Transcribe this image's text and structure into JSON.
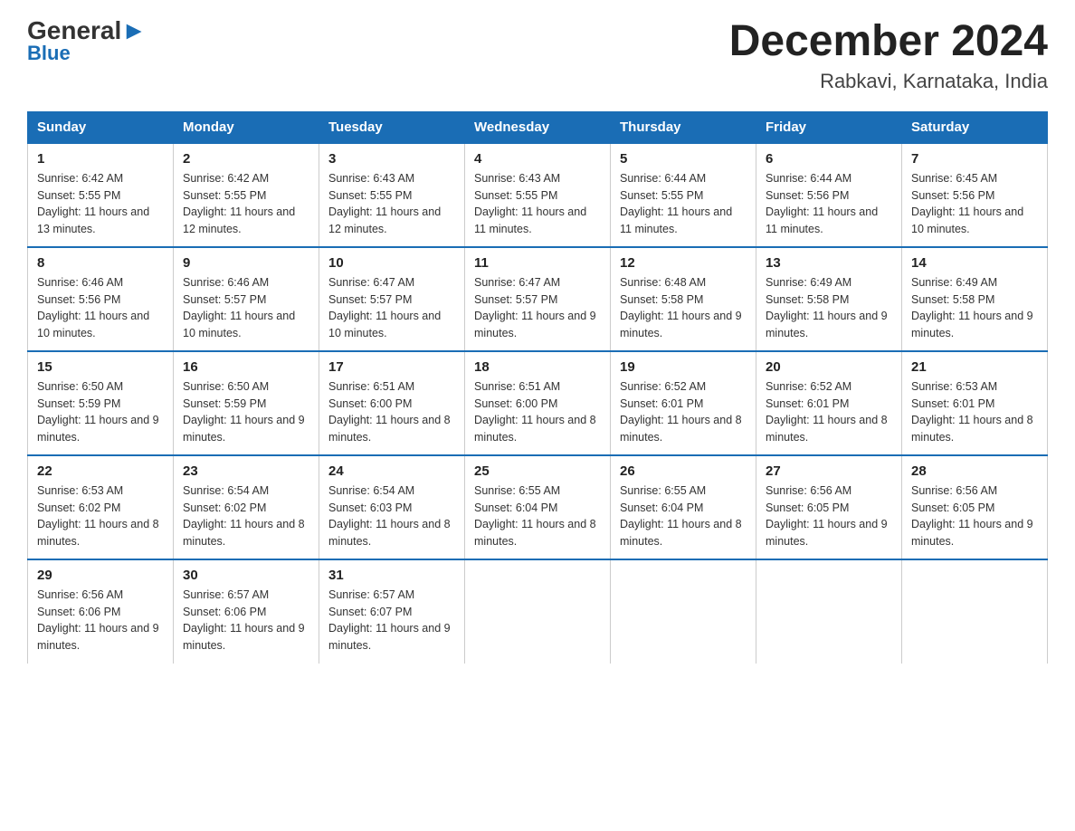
{
  "logo": {
    "general": "General",
    "blue": "Blue"
  },
  "title": "December 2024",
  "subtitle": "Rabkavi, Karnataka, India",
  "days": [
    "Sunday",
    "Monday",
    "Tuesday",
    "Wednesday",
    "Thursday",
    "Friday",
    "Saturday"
  ],
  "weeks": [
    [
      {
        "num": "1",
        "sunrise": "6:42 AM",
        "sunset": "5:55 PM",
        "daylight": "11 hours and 13 minutes."
      },
      {
        "num": "2",
        "sunrise": "6:42 AM",
        "sunset": "5:55 PM",
        "daylight": "11 hours and 12 minutes."
      },
      {
        "num": "3",
        "sunrise": "6:43 AM",
        "sunset": "5:55 PM",
        "daylight": "11 hours and 12 minutes."
      },
      {
        "num": "4",
        "sunrise": "6:43 AM",
        "sunset": "5:55 PM",
        "daylight": "11 hours and 11 minutes."
      },
      {
        "num": "5",
        "sunrise": "6:44 AM",
        "sunset": "5:55 PM",
        "daylight": "11 hours and 11 minutes."
      },
      {
        "num": "6",
        "sunrise": "6:44 AM",
        "sunset": "5:56 PM",
        "daylight": "11 hours and 11 minutes."
      },
      {
        "num": "7",
        "sunrise": "6:45 AM",
        "sunset": "5:56 PM",
        "daylight": "11 hours and 10 minutes."
      }
    ],
    [
      {
        "num": "8",
        "sunrise": "6:46 AM",
        "sunset": "5:56 PM",
        "daylight": "11 hours and 10 minutes."
      },
      {
        "num": "9",
        "sunrise": "6:46 AM",
        "sunset": "5:57 PM",
        "daylight": "11 hours and 10 minutes."
      },
      {
        "num": "10",
        "sunrise": "6:47 AM",
        "sunset": "5:57 PM",
        "daylight": "11 hours and 10 minutes."
      },
      {
        "num": "11",
        "sunrise": "6:47 AM",
        "sunset": "5:57 PM",
        "daylight": "11 hours and 9 minutes."
      },
      {
        "num": "12",
        "sunrise": "6:48 AM",
        "sunset": "5:58 PM",
        "daylight": "11 hours and 9 minutes."
      },
      {
        "num": "13",
        "sunrise": "6:49 AM",
        "sunset": "5:58 PM",
        "daylight": "11 hours and 9 minutes."
      },
      {
        "num": "14",
        "sunrise": "6:49 AM",
        "sunset": "5:58 PM",
        "daylight": "11 hours and 9 minutes."
      }
    ],
    [
      {
        "num": "15",
        "sunrise": "6:50 AM",
        "sunset": "5:59 PM",
        "daylight": "11 hours and 9 minutes."
      },
      {
        "num": "16",
        "sunrise": "6:50 AM",
        "sunset": "5:59 PM",
        "daylight": "11 hours and 9 minutes."
      },
      {
        "num": "17",
        "sunrise": "6:51 AM",
        "sunset": "6:00 PM",
        "daylight": "11 hours and 8 minutes."
      },
      {
        "num": "18",
        "sunrise": "6:51 AM",
        "sunset": "6:00 PM",
        "daylight": "11 hours and 8 minutes."
      },
      {
        "num": "19",
        "sunrise": "6:52 AM",
        "sunset": "6:01 PM",
        "daylight": "11 hours and 8 minutes."
      },
      {
        "num": "20",
        "sunrise": "6:52 AM",
        "sunset": "6:01 PM",
        "daylight": "11 hours and 8 minutes."
      },
      {
        "num": "21",
        "sunrise": "6:53 AM",
        "sunset": "6:01 PM",
        "daylight": "11 hours and 8 minutes."
      }
    ],
    [
      {
        "num": "22",
        "sunrise": "6:53 AM",
        "sunset": "6:02 PM",
        "daylight": "11 hours and 8 minutes."
      },
      {
        "num": "23",
        "sunrise": "6:54 AM",
        "sunset": "6:02 PM",
        "daylight": "11 hours and 8 minutes."
      },
      {
        "num": "24",
        "sunrise": "6:54 AM",
        "sunset": "6:03 PM",
        "daylight": "11 hours and 8 minutes."
      },
      {
        "num": "25",
        "sunrise": "6:55 AM",
        "sunset": "6:04 PM",
        "daylight": "11 hours and 8 minutes."
      },
      {
        "num": "26",
        "sunrise": "6:55 AM",
        "sunset": "6:04 PM",
        "daylight": "11 hours and 8 minutes."
      },
      {
        "num": "27",
        "sunrise": "6:56 AM",
        "sunset": "6:05 PM",
        "daylight": "11 hours and 9 minutes."
      },
      {
        "num": "28",
        "sunrise": "6:56 AM",
        "sunset": "6:05 PM",
        "daylight": "11 hours and 9 minutes."
      }
    ],
    [
      {
        "num": "29",
        "sunrise": "6:56 AM",
        "sunset": "6:06 PM",
        "daylight": "11 hours and 9 minutes."
      },
      {
        "num": "30",
        "sunrise": "6:57 AM",
        "sunset": "6:06 PM",
        "daylight": "11 hours and 9 minutes."
      },
      {
        "num": "31",
        "sunrise": "6:57 AM",
        "sunset": "6:07 PM",
        "daylight": "11 hours and 9 minutes."
      },
      null,
      null,
      null,
      null
    ]
  ]
}
